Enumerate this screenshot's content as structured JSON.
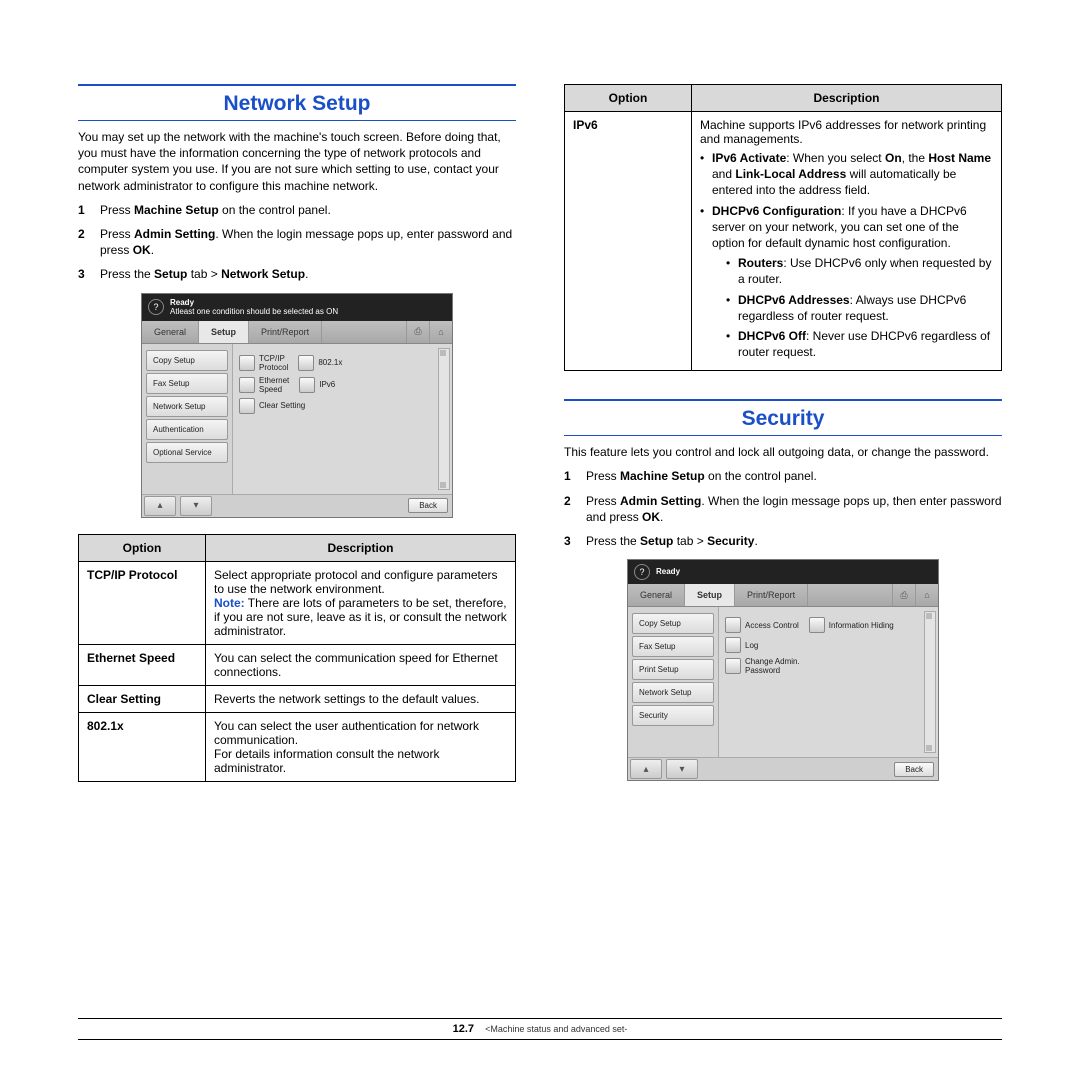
{
  "left": {
    "heading": "Network Setup",
    "intro": "You may set up the network with the machine's touch screen. Before doing that, you must have the information concerning the type of network protocols and computer system you use. If you are not sure which setting to use, contact your network administrator to configure this machine network.",
    "steps": {
      "s1a": "Press ",
      "s1b": "Machine Setup",
      "s1c": " on the control panel.",
      "s2a": "Press ",
      "s2b": "Admin Setting",
      "s2c": ". When the login message pops up, enter password and press ",
      "s2d": "OK",
      "s2e": ".",
      "s3a": "Press the ",
      "s3b": "Setup",
      "s3c": " tab > ",
      "s3d": "Network Setup",
      "s3e": "."
    },
    "ui1": {
      "status1": "Ready",
      "status2": "Atleast one condition should be selected as ON",
      "tabs": {
        "general": "General",
        "setup": "Setup",
        "print": "Print/Report"
      },
      "side": [
        "Copy Setup",
        "Fax Setup",
        "Network Setup",
        "Authentication",
        "Optional Service"
      ],
      "opts": {
        "tcpip": "TCP/IP\nProtocol",
        "x8021": "802.1x",
        "eth": "Ethernet\nSpeed",
        "ipv6": "IPv6",
        "clear": "Clear Setting"
      },
      "back": "Back"
    },
    "table1": {
      "h1": "Option",
      "h2": "Description",
      "r1o": "TCP/IP Protocol",
      "r1a": "Select appropriate protocol and configure parameters to use the network environment.",
      "r1note": "Note:",
      "r1b": " There are lots of parameters to be set, therefore, if you are not sure, leave as it is, or consult the network administrator.",
      "r2o": "Ethernet Speed",
      "r2": "You can select the communication speed for Ethernet connections.",
      "r3o": "Clear Setting",
      "r3": "Reverts the network settings to the default values.",
      "r4o": "802.1x",
      "r4a": "You can select the user authentication for network communication.",
      "r4b": "For details information consult the network administrator."
    }
  },
  "right": {
    "table2": {
      "h1": "Option",
      "h2": "Description",
      "ipv6_label": "IPv6",
      "ipv6_intro": "Machine supports IPv6 addresses for network printing and managements.",
      "act_b1": "IPv6 Activate",
      "act_t1": ": When you select ",
      "act_b2": "On",
      "act_t2": ", the ",
      "act_b3": "Host Name",
      "act_t3": " and ",
      "act_b4": "Link-Local Address",
      "act_t4": " will automatically be entered into the address field.",
      "dh_b": "DHCPv6 Configuration",
      "dh_t": ": If you have a DHCPv6 server on your network, you can set one of the option for default dynamic host configuration.",
      "ro_b": "Routers",
      "ro_t": ": Use DHCPv6 only when requested by a router.",
      "ad_b": "DHCPv6 Addresses",
      "ad_t": ": Always use DHCPv6 regardless of router request.",
      "off_b": "DHCPv6 Off",
      "off_t": ": Never use DHCPv6 regardless of router request."
    },
    "heading": "Security",
    "intro": "This feature lets you control and lock all outgoing data, or change the password.",
    "steps": {
      "s1a": "Press ",
      "s1b": "Machine Setup",
      "s1c": " on the control panel.",
      "s2a": "Press ",
      "s2b": "Admin Setting",
      "s2c": ". When the login message pops up, then enter password and press ",
      "s2d": "OK",
      "s2e": ".",
      "s3a": "Press the ",
      "s3b": "Setup",
      "s3c": " tab > ",
      "s3d": "Security",
      "s3e": "."
    },
    "ui2": {
      "status1": "Ready",
      "tabs": {
        "general": "General",
        "setup": "Setup",
        "print": "Print/Report"
      },
      "side": [
        "Copy Setup",
        "Fax Setup",
        "Print Setup",
        "Network Setup",
        "Security"
      ],
      "opts": {
        "access": "Access Control",
        "info": "Information Hiding",
        "log": "Log",
        "change": "Change Admin.\nPassword"
      },
      "back": "Back"
    }
  },
  "footer": {
    "page": "12.7",
    "chapter": "<Machine status and advanced set-"
  }
}
